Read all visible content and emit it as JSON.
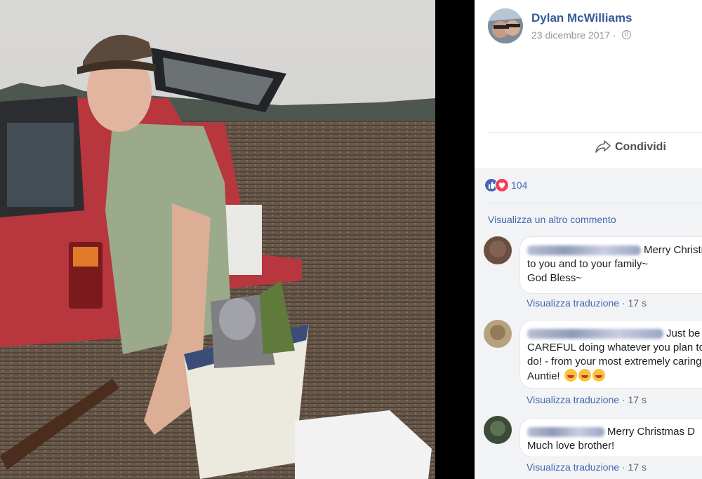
{
  "post": {
    "author": "Dylan McWilliams",
    "date": "23 dicembre 2017 · ",
    "privacy_icon": "globe-icon"
  },
  "actions": {
    "share_label": "Condividi"
  },
  "reactions": {
    "count": "104",
    "types": [
      "like",
      "love"
    ]
  },
  "comments": {
    "view_more": "Visualizza un altro commento",
    "items": [
      {
        "name_blurred": true,
        "text": "Merry Christmas to you and to your family~\nGod Bless~",
        "translate": "Visualizza traduzione",
        "time": "17 s"
      },
      {
        "name_blurred": true,
        "text": "Just be CAREFUL doing whatever you plan to do! - from your most extremely caring Auntie!",
        "emojis": [
          "squinting-face-with-tongue",
          "rolling-on-floor-laughing",
          "squinting-face-with-tongue"
        ],
        "translate": "Visualizza traduzione",
        "time": "17 s"
      },
      {
        "name_blurred": true,
        "text": "Merry Christmas D Much love brother!",
        "translate": "Visualizza traduzione",
        "time": "17 s"
      }
    ]
  },
  "colors": {
    "link": "#365899",
    "accent": "#4267b2",
    "muted": "#90949c",
    "panel_bg": "#f2f3f5"
  }
}
